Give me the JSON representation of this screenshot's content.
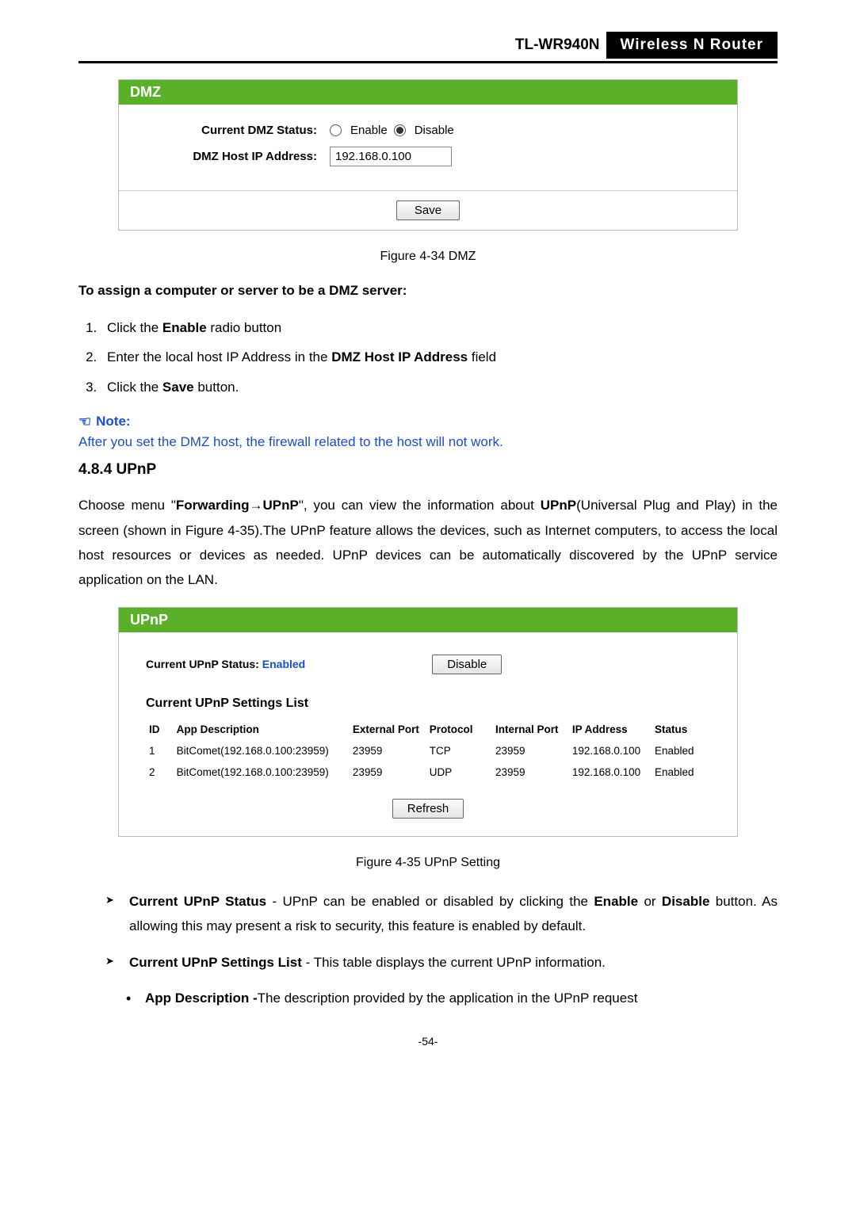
{
  "header": {
    "model": "TL-WR940N",
    "product": "Wireless  N  Router"
  },
  "dmzPanel": {
    "title": "DMZ",
    "statusLabel": "Current DMZ Status:",
    "enableLabel": "Enable",
    "disableLabel": "Disable",
    "ipLabel": "DMZ Host IP Address:",
    "ipValue": "192.168.0.100",
    "saveLabel": "Save"
  },
  "fig1": "Figure 4-34    DMZ",
  "dmzHowTitle": "To assign a computer or server to be a DMZ server:",
  "steps": {
    "s1a": "Click the ",
    "s1b": "Enable",
    "s1c": " radio button",
    "s2a": "Enter the local host IP Address in the ",
    "s2b": "DMZ Host IP Address",
    "s2c": " field",
    "s3a": "Click the ",
    "s3b": "Save",
    "s3c": " button."
  },
  "noteTitle": "Note:",
  "noteBody": "After you set the DMZ host, the firewall related to the host will not work.",
  "upnpHeading": "4.8.4  UPnP",
  "upnpPara": {
    "p1": "Choose menu \"",
    "p2": "Forwarding",
    "arrow": "→",
    "p3": "UPnP",
    "p4": "\", you can view the information about ",
    "p5": "UPnP",
    "p6": "(Universal Plug and Play) in the screen (shown in Figure 4-35).The UPnP feature allows the devices, such as Internet computers, to access the local host resources or devices as needed. UPnP devices can be automatically discovered by the UPnP service application on the LAN."
  },
  "upnpPanel": {
    "title": "UPnP",
    "statusLabel": "Current UPnP Status: ",
    "statusValue": "Enabled",
    "disableBtn": "Disable",
    "listTitle": "Current UPnP Settings List",
    "headers": {
      "id": "ID",
      "app": "App Description",
      "ext": "External Port",
      "proto": "Protocol",
      "int": "Internal Port",
      "ip": "IP Address",
      "status": "Status"
    },
    "rows": [
      {
        "id": "1",
        "app": "BitComet(192.168.0.100:23959)",
        "ext": "23959",
        "proto": "TCP",
        "int": "23959",
        "ip": "192.168.0.100",
        "status": "Enabled"
      },
      {
        "id": "2",
        "app": "BitComet(192.168.0.100:23959)",
        "ext": "23959",
        "proto": "UDP",
        "int": "23959",
        "ip": "192.168.0.100",
        "status": "Enabled"
      }
    ],
    "refreshLabel": "Refresh"
  },
  "fig2": "Figure 4-35    UPnP Setting",
  "bullets": {
    "b1a": "Current UPnP Status",
    "b1b": " - UPnP can be enabled or disabled by clicking the ",
    "b1c": "Enable",
    "b1d": " or ",
    "b1e": "Disable",
    "b1f": " button. As allowing this may present a risk to security, this feature is enabled by default.",
    "b2a": "Current UPnP Settings List",
    "b2b": " - This table displays the current UPnP information.",
    "b3a": "App Description -",
    "b3b": "The description provided by the application in the UPnP request"
  },
  "pageNum": "-54-"
}
